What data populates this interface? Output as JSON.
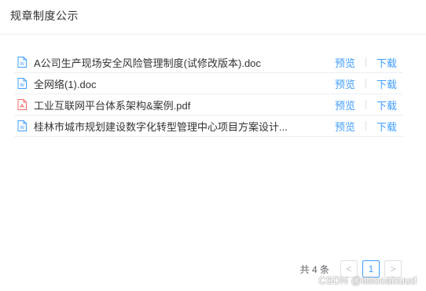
{
  "header": {
    "title": "规章制度公示"
  },
  "files": [
    {
      "name": "A公司生产现场安全风险管理制度(试修改版本).doc",
      "type": "word",
      "preview": "预览",
      "download": "下载"
    },
    {
      "name": "全网络(1).doc",
      "type": "word",
      "preview": "预览",
      "download": "下载"
    },
    {
      "name": "工业互联网平台体系架构&案例.pdf",
      "type": "pdf",
      "preview": "预览",
      "download": "下载"
    },
    {
      "name": "桂林市城市规划建设数字化转型管理中心项目方案设计...",
      "type": "word",
      "preview": "预览",
      "download": "下载"
    }
  ],
  "pagination": {
    "total_label": "共 4 条",
    "prev": "<",
    "current": "1",
    "next": ">"
  },
  "watermark": "CSDN @iiiiiooaixuud",
  "colors": {
    "link": "#409eff",
    "word_icon": "#409eff",
    "pdf_icon": "#f56c6c",
    "border": "#ebeef5"
  }
}
